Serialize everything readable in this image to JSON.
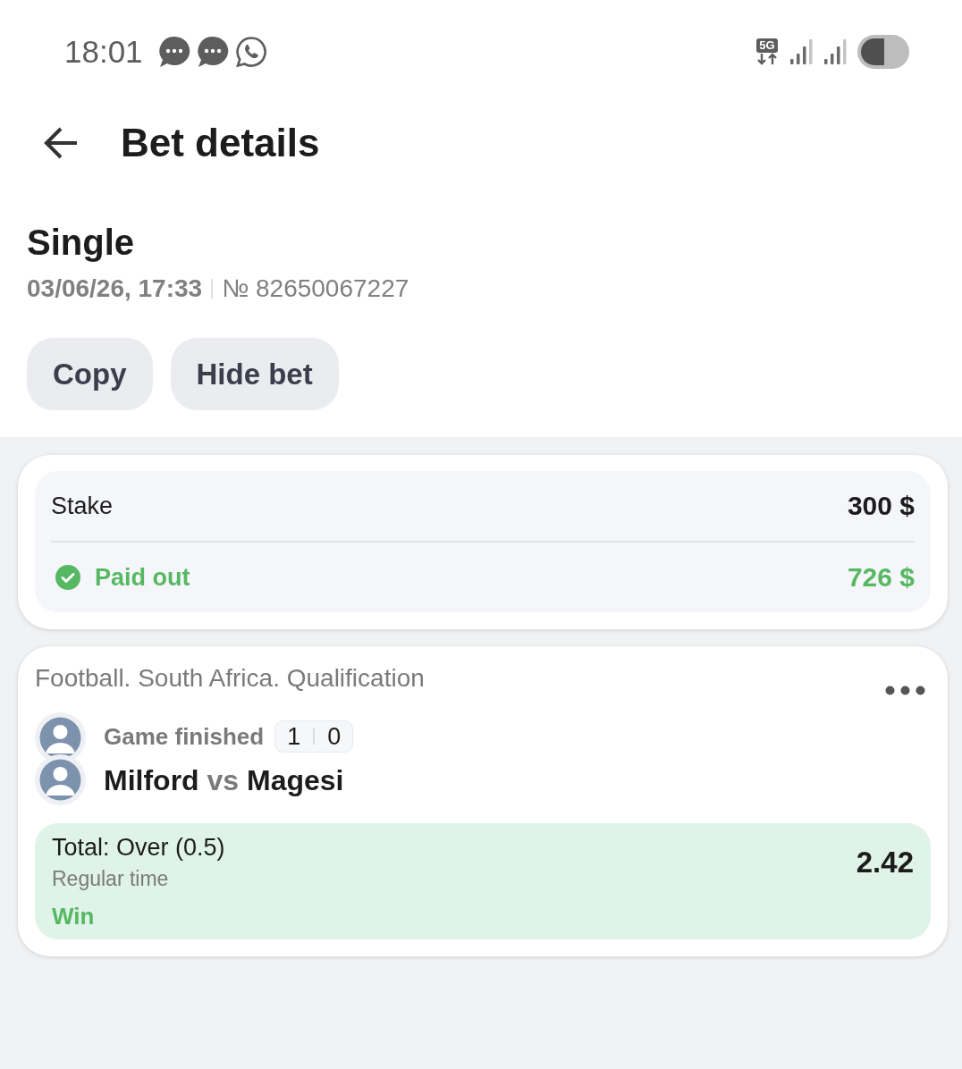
{
  "status_bar": {
    "time": "18:01",
    "network": "5G"
  },
  "header": {
    "title": "Bet details"
  },
  "bet": {
    "type": "Single",
    "date": "03/06/26, 17:33",
    "number": "№ 82650067227"
  },
  "actions": [
    {
      "label": "Copy"
    },
    {
      "label": "Hide bet"
    }
  ],
  "summary": [
    {
      "kind": "stake",
      "label": "Stake",
      "value": "300 $"
    },
    {
      "kind": "paid",
      "label": "Paid out",
      "value": "726 $"
    }
  ],
  "event": {
    "category": "Football. South Africa. Qualification",
    "status": "Game finished",
    "score": [
      "1",
      "0"
    ],
    "home": "Milford",
    "separator": "vs",
    "away": "Magesi",
    "selection": {
      "market": "Total: Over (0.5)",
      "period": "Regular time",
      "result": "Win",
      "won": true,
      "odds": "2.42"
    }
  }
}
